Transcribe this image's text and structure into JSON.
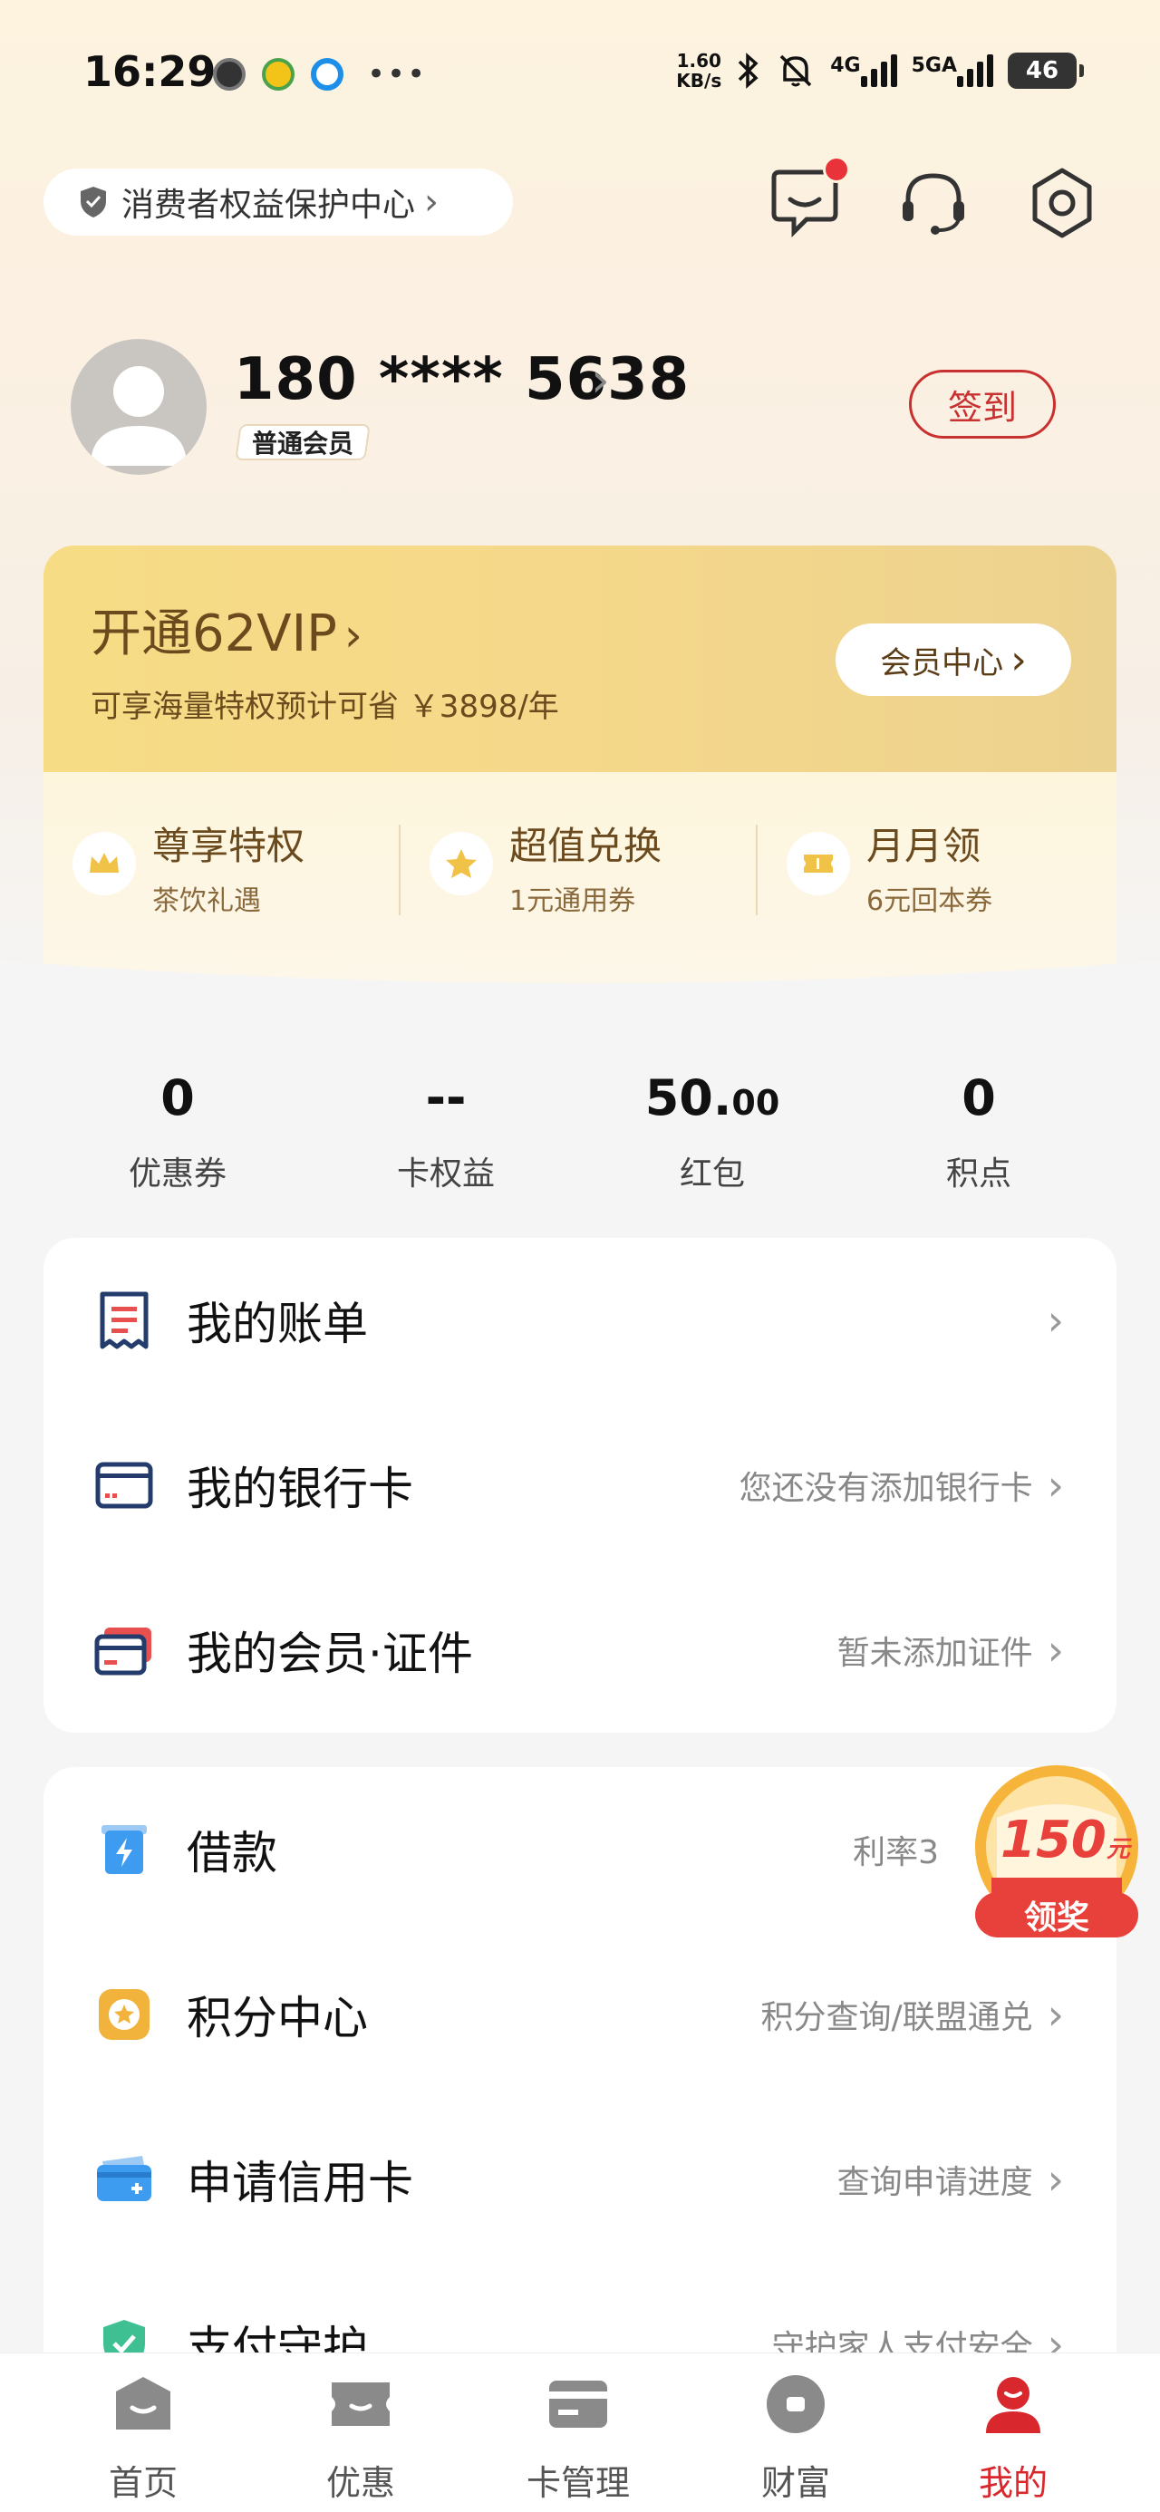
{
  "status_bar": {
    "time": "16:29",
    "speed_value": "1.60",
    "speed_unit": "KB/s",
    "net_4g": "4G",
    "net_5g": "5GA",
    "battery": "46"
  },
  "header": {
    "consumer_center": "消费者权益保护中心"
  },
  "profile": {
    "phone": "180 **** 5638",
    "member_level": "普通会员",
    "checkin_label": "签到"
  },
  "vip": {
    "title": "开通62VIP",
    "subtitle": "可享海量特权预计可省 ￥3898/年",
    "center_button": "会员中心",
    "perks": [
      {
        "title": "尊享特权",
        "subtitle": "茶饮礼遇"
      },
      {
        "title": "超值兑换",
        "subtitle": "1元通用券"
      },
      {
        "title": "月月领",
        "subtitle": "6元回本券"
      }
    ]
  },
  "stats": [
    {
      "value": "0",
      "label": "优惠券"
    },
    {
      "value": "--",
      "label": "卡权益"
    },
    {
      "value": "50.",
      "value_small": "00",
      "label": "红包"
    },
    {
      "value": "0",
      "label": "积点"
    }
  ],
  "card1": [
    {
      "title": "我的账单",
      "right": ""
    },
    {
      "title": "我的银行卡",
      "right": "您还没有添加银行卡"
    },
    {
      "title": "我的会员·证件",
      "right": "暂未添加证件"
    }
  ],
  "card2": [
    {
      "title": "借款",
      "right": "利率3"
    },
    {
      "title": "积分中心",
      "right": "积分查询/联盟通兑"
    },
    {
      "title": "申请信用卡",
      "right": "查询申请进度"
    },
    {
      "title": "支付守护",
      "right": "守护家人支付安全"
    }
  ],
  "award": {
    "amount": "150",
    "unit": "元",
    "label": "领奖"
  },
  "tabs": [
    {
      "label": "首页"
    },
    {
      "label": "优惠"
    },
    {
      "label": "卡管理"
    },
    {
      "label": "财富"
    },
    {
      "label": "我的"
    }
  ],
  "colors": {
    "accent": "#d8282d",
    "vip_gold": "#f5d88a",
    "vip_text": "#6b4a1e"
  }
}
